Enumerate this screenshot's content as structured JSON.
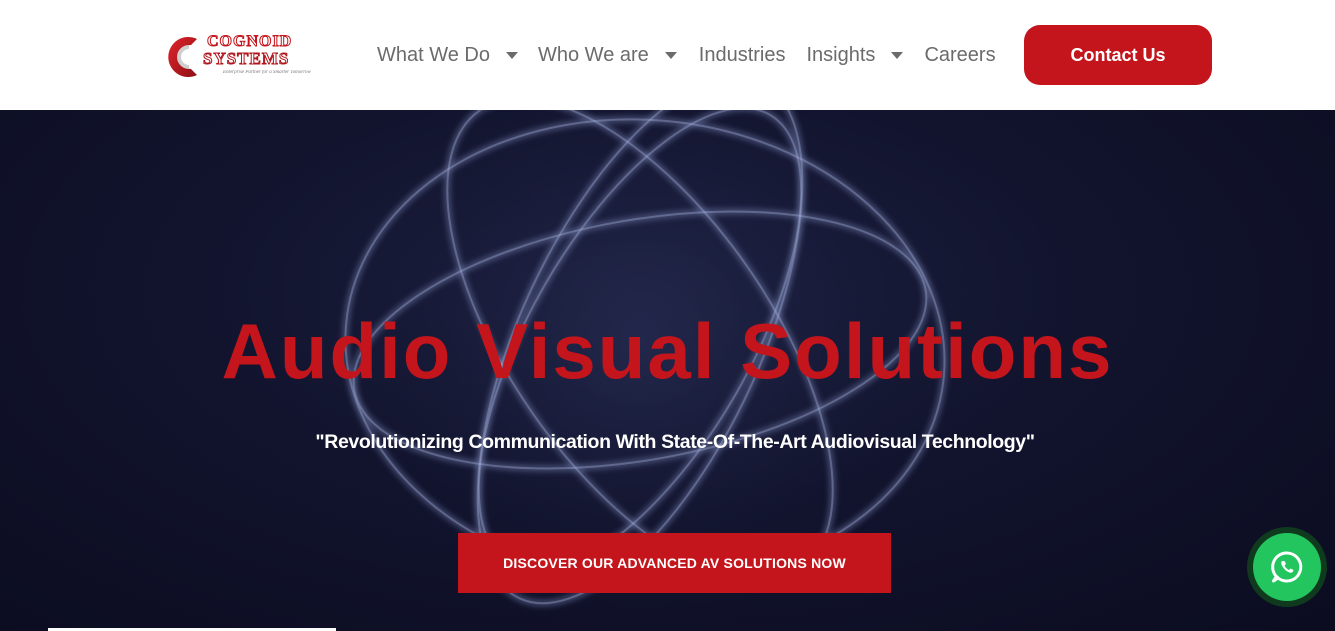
{
  "brand": {
    "line1": "COGNOID",
    "line2": "SYSTEMS",
    "tagline": "Enterprise Partner for a Smarter Tomorrow",
    "primary_color": "#c4151c"
  },
  "nav": {
    "items": [
      {
        "label": "What We Do",
        "has_dropdown": true
      },
      {
        "label": "Who We are",
        "has_dropdown": true
      },
      {
        "label": "Industries",
        "has_dropdown": false
      },
      {
        "label": "Insights",
        "has_dropdown": true
      },
      {
        "label": "Careers",
        "has_dropdown": false
      }
    ],
    "contact_label": "Contact Us"
  },
  "hero": {
    "title": "Audio Visual Solutions",
    "subtitle": "\"Revolutionizing Communication With State-Of-The-Art Audiovisual Technology\"",
    "cta_label": "DISCOVER OUR ADVANCED AV SOLUTIONS NOW",
    "background_color": "#12142e"
  },
  "floating": {
    "whatsapp_icon": "whatsapp-icon",
    "whatsapp_color": "#22c55e"
  }
}
